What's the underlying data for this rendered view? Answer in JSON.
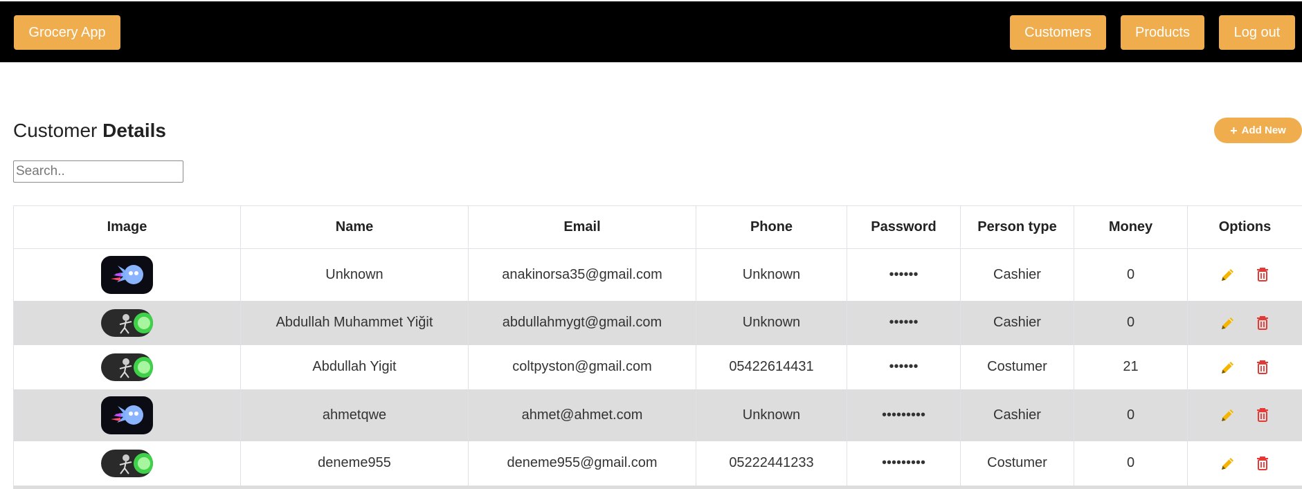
{
  "nav": {
    "brand": "Grocery App",
    "customers": "Customers",
    "products": "Products",
    "logout": "Log out"
  },
  "page": {
    "title_light": "Customer ",
    "title_bold": "Details",
    "add_new": "Add New",
    "search_placeholder": "Search.."
  },
  "table": {
    "headers": [
      "Image",
      "Name",
      "Email",
      "Phone",
      "Password",
      "Person type",
      "Money",
      "Options"
    ],
    "rows": [
      {
        "image": "avatar-rick",
        "name": "Unknown",
        "email": "anakinorsa35@gmail.com",
        "phone": "Unknown",
        "password": "••••••",
        "type": "Cashier",
        "money": "0"
      },
      {
        "image": "avatar-portal",
        "name": "Abdullah Muhammet Yiğit",
        "email": "abdullahmygt@gmail.com",
        "phone": "Unknown",
        "password": "••••••",
        "type": "Cashier",
        "money": "0"
      },
      {
        "image": "avatar-portal",
        "name": "Abdullah Yigit",
        "email": "coltpyston@gmail.com",
        "phone": "05422614431",
        "password": "••••••",
        "type": "Costumer",
        "money": "21"
      },
      {
        "image": "avatar-rick",
        "name": "ahmetqwe",
        "email": "ahmet@ahmet.com",
        "phone": "Unknown",
        "password": "•••••••••",
        "type": "Cashier",
        "money": "0"
      },
      {
        "image": "avatar-portal",
        "name": "deneme955",
        "email": "deneme955@gmail.com",
        "phone": "05222441233",
        "password": "•••••••••",
        "type": "Costumer",
        "money": "0"
      }
    ]
  },
  "colors": {
    "accent": "#f0ad4e",
    "edit_icon": "#f5b400",
    "delete_icon": "#e53935",
    "topbar": "#000000",
    "row_alt": "#dddddd"
  },
  "icons": {
    "edit": "pencil-icon",
    "delete": "trash-icon",
    "add": "plus-icon"
  }
}
